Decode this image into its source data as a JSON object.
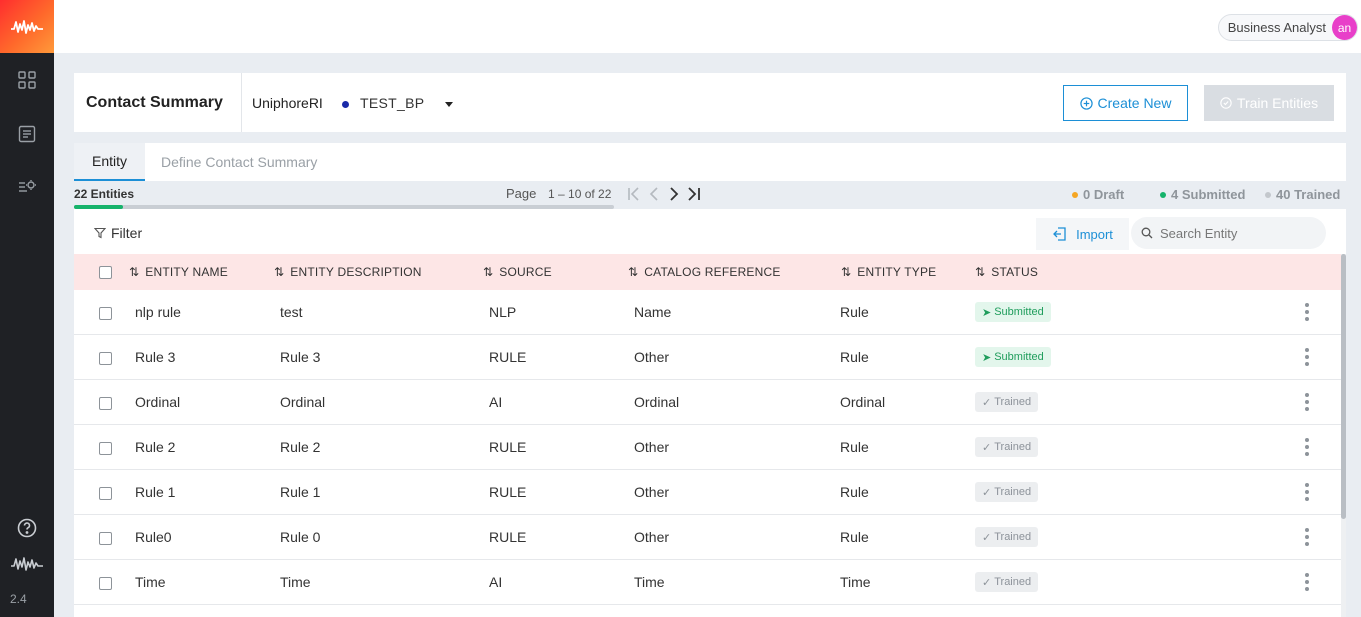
{
  "app": {
    "version": "2.4"
  },
  "topbar": {
    "user_role": "Business Analyst",
    "avatar_initials": "an",
    "avatar_color": "#e83fc9"
  },
  "header": {
    "title": "Contact Summary",
    "project": "UniphoreRI",
    "environment": "TEST_BP",
    "create_label": "Create New",
    "train_label": "Train Entities"
  },
  "tabs": [
    {
      "label": "Entity",
      "active": true
    },
    {
      "label": "Define Contact Summary",
      "active": false
    }
  ],
  "summary": {
    "entity_count_label": "22 Entities",
    "progress_fraction": 0.09,
    "page_label": "Page",
    "page_range": "1 – 10 of 22",
    "draft": "0 Draft",
    "submitted": "4 Submitted",
    "trained": "40 Trained",
    "colors": {
      "draft": "#f5a623",
      "submitted": "#16b36b",
      "trained": "#c3c7cc"
    }
  },
  "toolbar": {
    "filter_label": "Filter",
    "import_label": "Import",
    "search_placeholder": "Search Entity"
  },
  "table": {
    "columns": [
      "ENTITY NAME",
      "ENTITY DESCRIPTION",
      "SOURCE",
      "CATALOG REFERENCE",
      "ENTITY TYPE",
      "STATUS"
    ],
    "rows": [
      {
        "name": "nlp rule",
        "description": "test",
        "source": "NLP",
        "catalog": "Name",
        "type": "Rule",
        "status": "Submitted"
      },
      {
        "name": "Rule 3",
        "description": "Rule 3",
        "source": "RULE",
        "catalog": "Other",
        "type": "Rule",
        "status": "Submitted"
      },
      {
        "name": "Ordinal",
        "description": "Ordinal",
        "source": "AI",
        "catalog": "Ordinal",
        "type": "Ordinal",
        "status": "Trained"
      },
      {
        "name": "Rule 2",
        "description": "Rule 2",
        "source": "RULE",
        "catalog": "Other",
        "type": "Rule",
        "status": "Trained"
      },
      {
        "name": "Rule 1",
        "description": "Rule 1",
        "source": "RULE",
        "catalog": "Other",
        "type": "Rule",
        "status": "Trained"
      },
      {
        "name": "Rule0",
        "description": "Rule 0",
        "source": "RULE",
        "catalog": "Other",
        "type": "Rule",
        "status": "Trained"
      },
      {
        "name": "Time",
        "description": "Time",
        "source": "AI",
        "catalog": "Time",
        "type": "Time",
        "status": "Trained"
      }
    ]
  },
  "icons": {
    "logo": "waveform-logo-icon",
    "nav": [
      "grid-icon",
      "document-icon",
      "settings-list-icon",
      "help-icon",
      "waveform-icon"
    ],
    "pager": [
      "first-page-icon",
      "prev-page-icon",
      "next-page-icon",
      "last-page-icon"
    ]
  }
}
